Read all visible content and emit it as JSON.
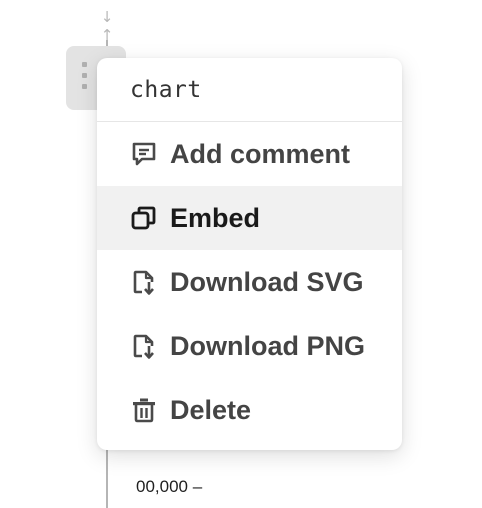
{
  "menu": {
    "title": "chart",
    "items": [
      {
        "label": "Add comment",
        "icon": "comment-icon",
        "active": false
      },
      {
        "label": "Embed",
        "icon": "embed-icon",
        "active": true
      },
      {
        "label": "Download SVG",
        "icon": "download-file-icon",
        "active": false
      },
      {
        "label": "Download PNG",
        "icon": "download-file-icon",
        "active": false
      },
      {
        "label": "Delete",
        "icon": "trash-icon",
        "active": false
      }
    ]
  },
  "axis": {
    "tick_label": "00,000 –"
  },
  "colors": {
    "icon": "#4a4a4a",
    "icon_active": "#1a1a1a",
    "hover_bg": "#f1f1f1"
  }
}
